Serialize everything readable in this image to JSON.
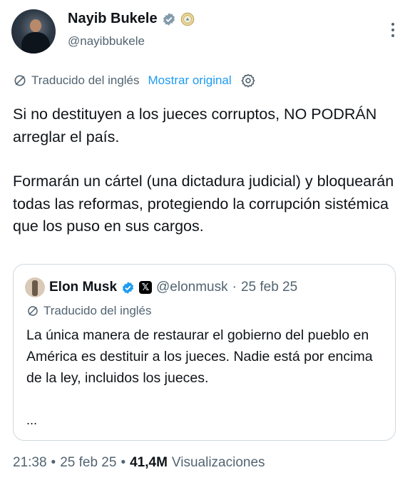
{
  "author": {
    "name": "Nayib Bukele",
    "handle": "@nayibbukele",
    "verified_icon": "verified-badge-icon",
    "affiliation_icon": "government-seal-icon"
  },
  "translation": {
    "label": "Traducido del inglés",
    "show_original": "Mostrar original"
  },
  "tweet": {
    "paragraph1": "Si no destituyen a los jueces corruptos, NO PODRÁN arreglar el país.",
    "paragraph2": "Formarán un cártel (una dictadura judicial) y bloquearán todas las reformas, protegiendo la corrupción sistémica que los puso en sus cargos."
  },
  "quote": {
    "name": "Elon Musk",
    "x_badge": "𝕏",
    "handle": "@elonmusk",
    "separator": "·",
    "date": "25 feb 25",
    "translated_label": "Traducido del inglés",
    "text": "La única manera de restaurar el gobierno del pueblo en América es destituir a los jueces. Nadie está por encima de la ley, incluidos los jueces.",
    "ellipsis": "..."
  },
  "meta": {
    "time": "21:38",
    "sep1": "•",
    "date": "25 feb 25",
    "sep2": "•",
    "views_count": "41,4M",
    "views_label": "Visualizaciones"
  },
  "colors": {
    "text": "#0f1419",
    "secondary": "#536471",
    "accent": "#1d9bf0",
    "border": "#cfd9de"
  }
}
